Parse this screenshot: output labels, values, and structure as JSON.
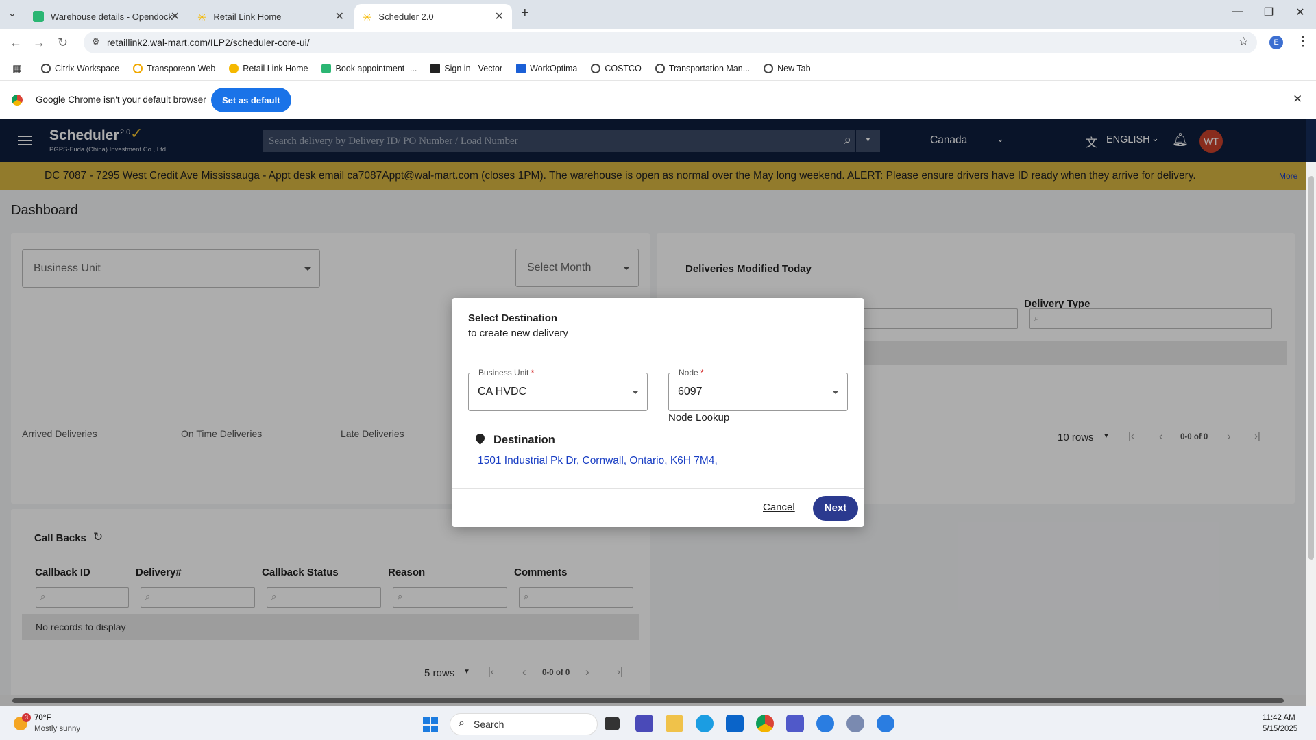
{
  "browser": {
    "tabs": [
      {
        "title": "Warehouse details - Opendock"
      },
      {
        "title": "Retail Link Home"
      },
      {
        "title": "Scheduler 2.0"
      }
    ],
    "url": "retaillink2.wal-mart.com/ILP2/scheduler-core-ui/",
    "profile_initial": "E",
    "bookmarks": [
      "Citrix Workspace",
      "Transporeon-Web",
      "Retail Link Home",
      "Book appointment -...",
      "Sign in - Vector",
      "WorkOptima",
      "COSTCO",
      "Transportation Man...",
      "New Tab"
    ],
    "default_bar": {
      "message": "Google Chrome isn't your default browser",
      "button": "Set as default"
    }
  },
  "app": {
    "name": "Scheduler",
    "version": "2.0",
    "subtitle": "PGPS-Fuda (China) Investment Co., Ltd",
    "search_placeholder": "Search delivery by Delivery ID/ PO Number / Load Number",
    "country": "Canada",
    "language": "ENGLISH",
    "avatar": "WT",
    "alert": "DC 7087 - 7295 West Credit Ave Mississauga - Appt desk email ca7087Appt@wal-mart.com (closes 1PM). The warehouse is open as normal over the May long weekend. ALERT: Please ensure drivers have ID ready when they arrive for delivery.",
    "alert_more": "More"
  },
  "dashboard": {
    "title": "Dashboard",
    "business_unit_placeholder": "Business Unit",
    "month_placeholder": "Select Month",
    "stats": [
      "Arrived Deliveries",
      "On Time Deliveries",
      "Late Deliveries"
    ],
    "modified_title": "Deliveries Modified Today",
    "modified_col_type": "Delivery Type",
    "modified_rows": "10 rows",
    "modified_range": "0-0 of 0",
    "callbacks": {
      "title": "Call Backs",
      "columns": [
        "Callback ID",
        "Delivery#",
        "Callback Status",
        "Reason",
        "Comments"
      ],
      "empty": "No records to display",
      "rows": "5 rows",
      "range": "0-0 of 0"
    }
  },
  "modal": {
    "title": "Select Destination",
    "subtitle": "to create new delivery",
    "business_unit_label": "Business Unit",
    "business_unit_value": "CA HVDC",
    "node_label": "Node",
    "node_value": "6097",
    "node_lookup": "Node Lookup",
    "destination_label": "Destination",
    "destination_address": "1501 Industrial Pk Dr, Cornwall, Ontario, K6H 7M4,",
    "cancel": "Cancel",
    "next": "Next"
  },
  "taskbar": {
    "weather_temp": "70°F",
    "weather_desc": "Mostly sunny",
    "weather_badge": "3",
    "search": "Search",
    "time": "11:42 AM",
    "date": "5/15/2025"
  },
  "colors": {
    "header_bg": "#0e1e3d",
    "alert_bg": "#d8b541",
    "primary_btn": "#2b3a8f",
    "link": "#1a3fc4",
    "avatar": "#c9412c"
  }
}
